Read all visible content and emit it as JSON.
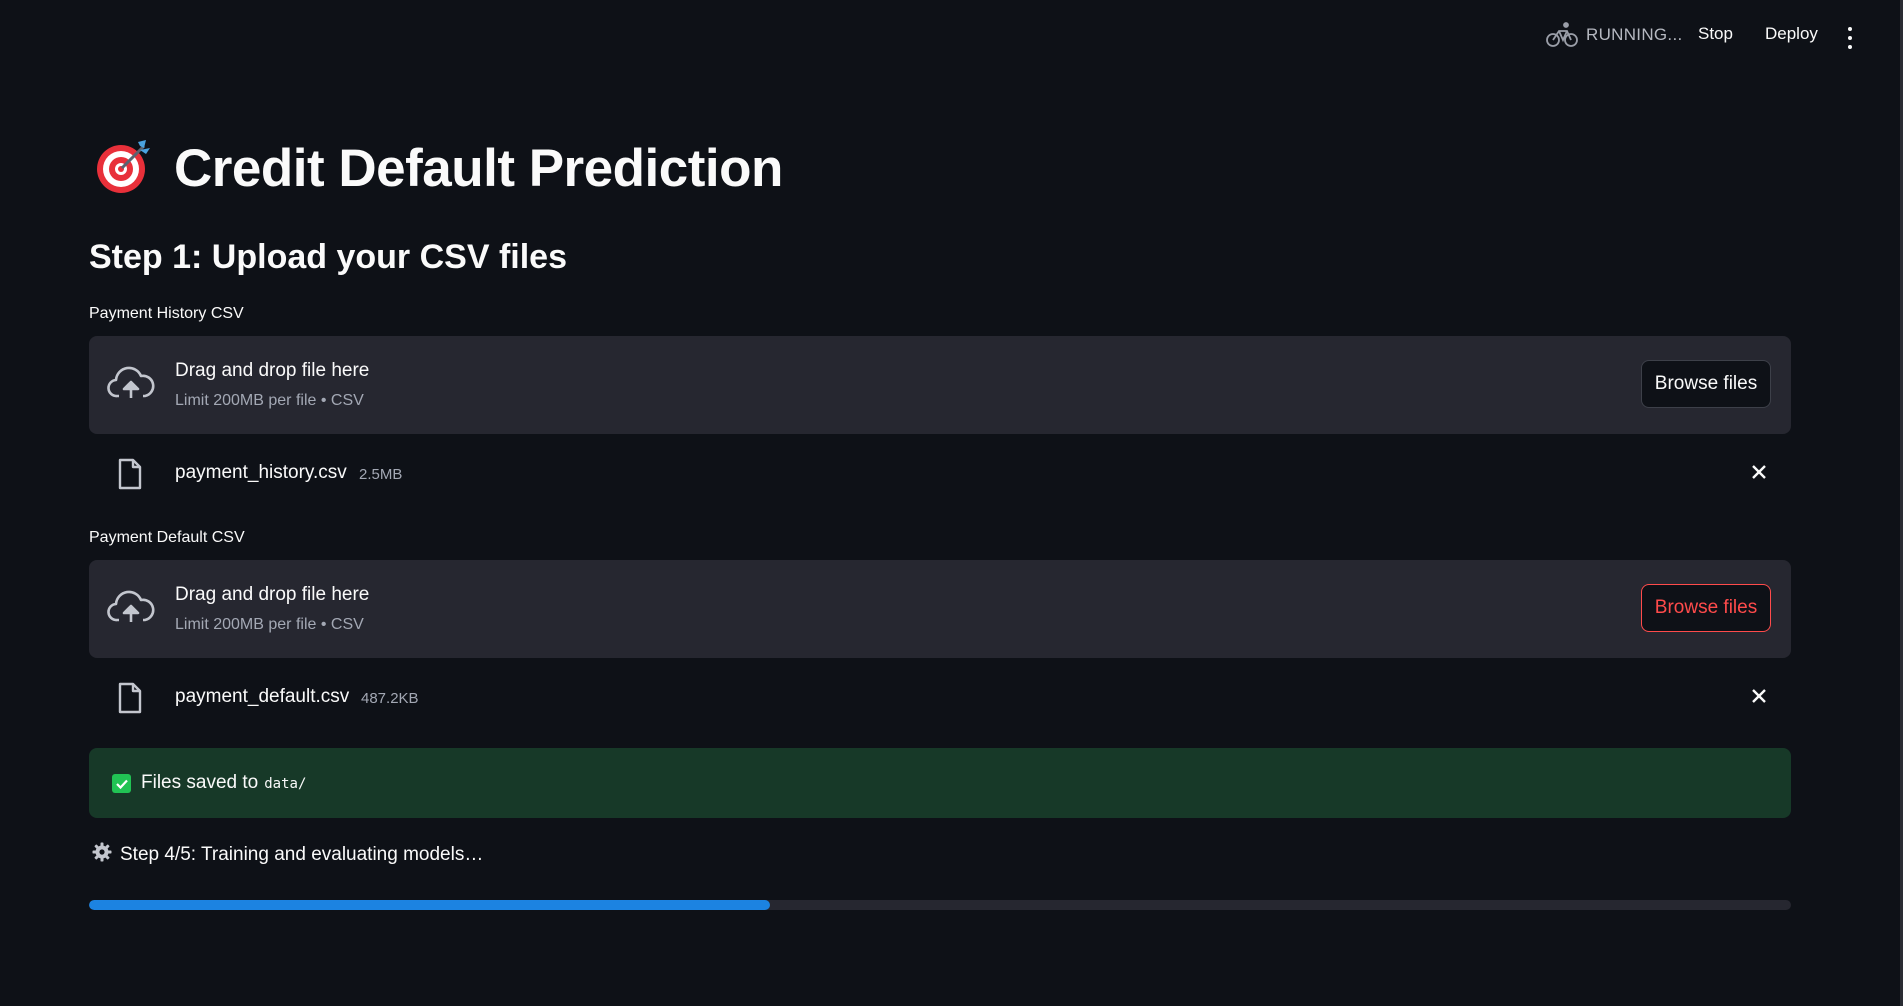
{
  "header": {
    "status_text": "RUNNING...",
    "stop_label": "Stop",
    "deploy_label": "Deploy"
  },
  "page": {
    "title": "Credit Default Prediction",
    "step_heading": "Step 1: Upload your CSV files"
  },
  "uploaders": [
    {
      "label": "Payment History CSV",
      "dropzone_title": "Drag and drop file here",
      "dropzone_subtitle": "Limit 200MB per file • CSV",
      "browse_label": "Browse files",
      "file": {
        "name": "payment_history.csv",
        "size": "2.5MB"
      }
    },
    {
      "label": "Payment Default CSV",
      "dropzone_title": "Drag and drop file here",
      "dropzone_subtitle": "Limit 200MB per file • CSV",
      "browse_label": "Browse files",
      "file": {
        "name": "payment_default.csv",
        "size": "487.2KB"
      }
    }
  ],
  "success": {
    "text": "Files saved to",
    "code": "data/"
  },
  "progress": {
    "label": "Step 4/5: Training and evaluating models…",
    "fraction": 0.4
  },
  "colors": {
    "background": "#0e1117",
    "surface": "#262730",
    "accent_red": "#ff4b4b",
    "success_bg": "#173928",
    "success_icon": "#21c354",
    "progress_fill": "#1c83e1"
  },
  "icons": {
    "status": "bicycle-icon",
    "menu": "kebab-menu-icon",
    "title_emoji": "target-dart-icon",
    "upload": "cloud-upload-icon",
    "file": "file-icon",
    "remove": "close-icon",
    "success": "check-box-icon",
    "progress": "gear-icon"
  }
}
